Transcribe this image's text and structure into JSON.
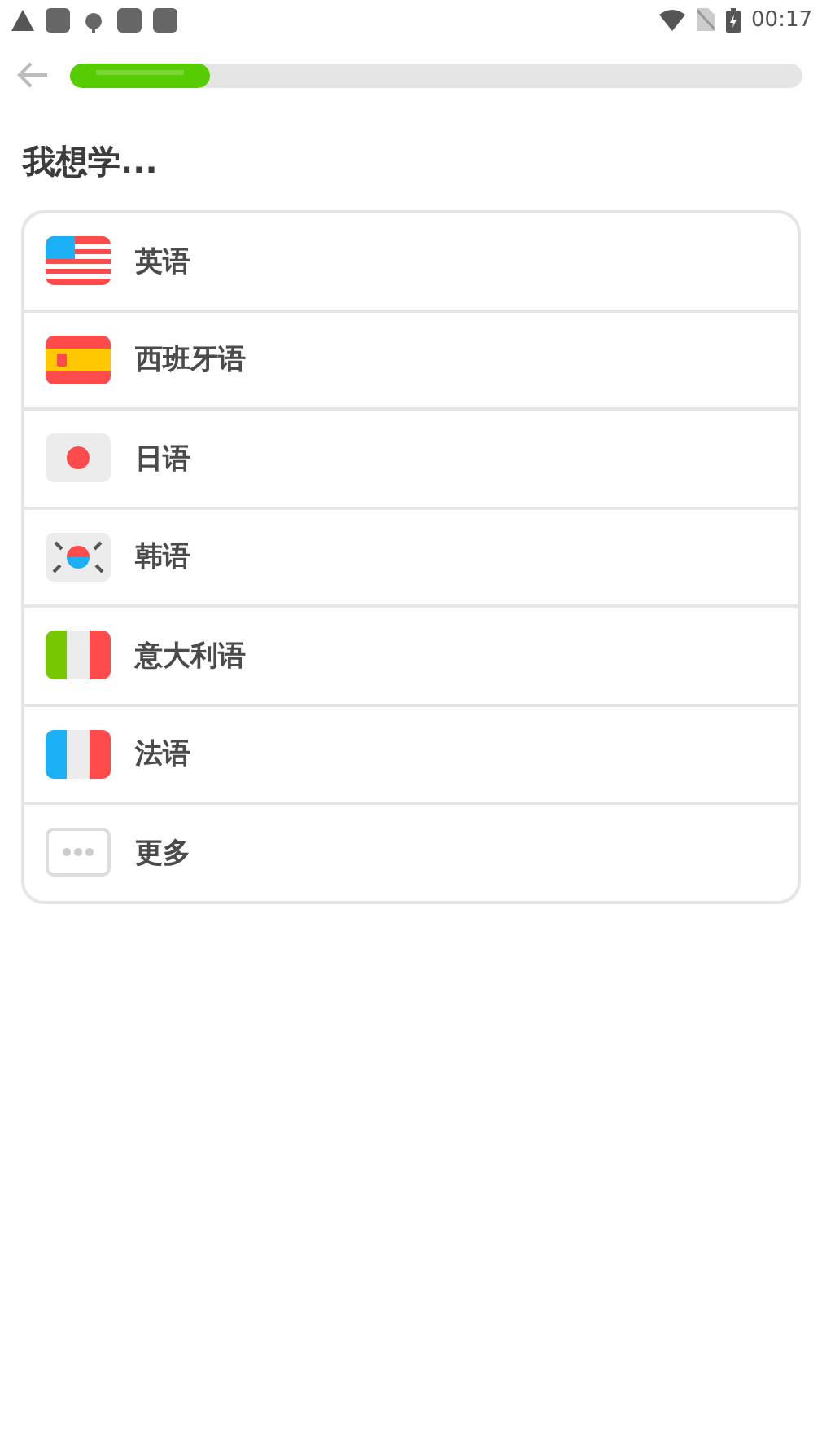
{
  "status_bar": {
    "time": "00:17"
  },
  "progress": {
    "level": 0.19
  },
  "title": "我想学...",
  "languages": [
    {
      "kind": "us",
      "label": "英语"
    },
    {
      "kind": "es",
      "label": "西班牙语"
    },
    {
      "kind": "jp",
      "label": "日语"
    },
    {
      "kind": "kr",
      "label": "韩语"
    },
    {
      "kind": "it",
      "label": "意大利语"
    },
    {
      "kind": "fr",
      "label": "法语"
    },
    {
      "kind": "more",
      "label": "更多"
    }
  ]
}
